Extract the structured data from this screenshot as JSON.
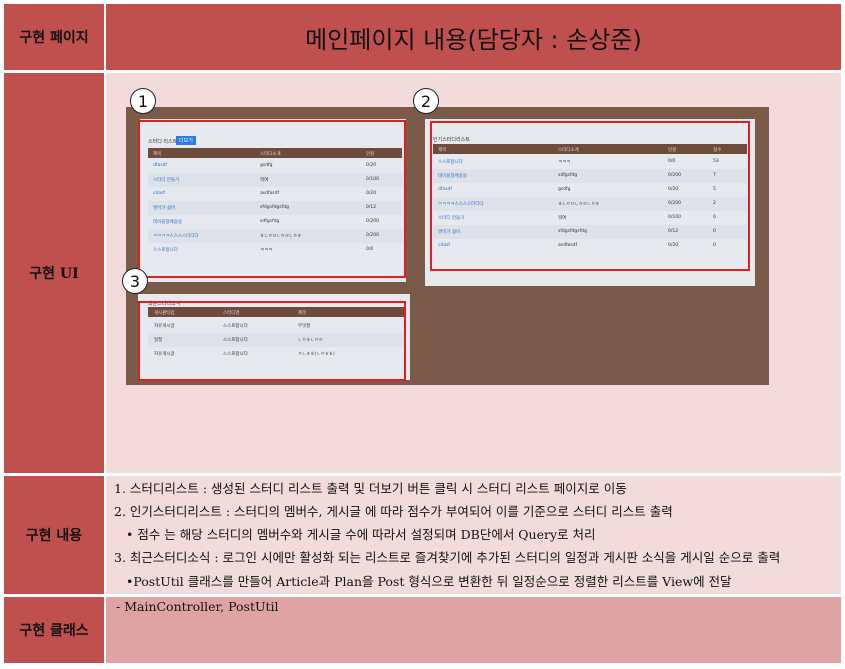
{
  "header": {
    "label": "구현 페이지",
    "title": "메인페이지 내용(담당자 : 손상준)"
  },
  "ui_section": {
    "label": "구현 UI"
  },
  "content_section": {
    "label": "구현 내용",
    "lines": [
      "1. 스터디리스트 : 생성된 스터디 리스트 출력 및 더보기 버튼 클릭 시 스터디 리스트 페이지로 이동",
      "2. 인기스터디리스트 : 스터디의 멤버수, 게시글 에 따라 점수가 부여되어 이를 기준으로 스터디 리스트 출력",
      "• 점수 는 해당 스터디의 멤버수와 게시글 수에 따라서 설정되며 DB단에서 Query로 처리",
      "3. 최근스터디소식 : 로그인 시에만 활성화 되는 리스트로 즐겨찾기에 추가된 스터디의 일정과 게시판 소식을 게시일 순으로 출력",
      "•PostUtil 클래스를 만들어 Article과 Plan을 Post 형식으로 변환한 뒤 일정순으로 정렬한 리스트를 View에 전달"
    ]
  },
  "class_section": {
    "label": "구현 클래스",
    "text": "- MainController, PostUtil"
  },
  "badges": [
    "1",
    "2",
    "3"
  ],
  "panel1": {
    "title": "스터디 리스트",
    "more": "더보기",
    "headers": [
      "제목",
      "스터디소개",
      "인원"
    ],
    "rows": [
      [
        "dfasdf",
        "gsdfg",
        "0/20"
      ],
      [
        "스터디 만들기",
        "뭐여",
        "0/100"
      ],
      [
        "cdasf",
        "asdfasdf",
        "0/20"
      ],
      [
        "영어가 싫어",
        "sfdgsfdgsfdg",
        "0/12"
      ],
      [
        "테이블형페용용",
        "sdfgsfdg",
        "0/200"
      ],
      [
        "ㅋㅋㅋㅋ스스스스터디다",
        "ㅎㄴㅇㅁㄴㅇㄹㄴㅇㅎ",
        "0/200"
      ],
      [
        "스스로합니다",
        "ㅋㅋㅋ",
        "0/0"
      ]
    ]
  },
  "panel2": {
    "title": "인기스터디리스트",
    "headers": [
      "제목",
      "스터디소개",
      "인원",
      "점수"
    ],
    "rows": [
      [
        "스스로합니다",
        "ㅋㅋㅋ",
        "0/0",
        "53"
      ],
      [
        "테이블형페용용",
        "sdfgsfdg",
        "0/200",
        "7"
      ],
      [
        "dfasdf",
        "gsdfg",
        "0/20",
        "5"
      ],
      [
        "ㅋㅋㅋㅋ스스스스터디다",
        "ㅎㄴㅇㅁㄴㅇㄹㄴㅇㅎ",
        "0/200",
        "2"
      ],
      [
        "스터디 만들기",
        "뭐여",
        "0/100",
        "0"
      ],
      [
        "영어가 싫어",
        "sfdgsfdgsfdg",
        "0/12",
        "0"
      ],
      [
        "cdasf",
        "asdfasdf",
        "0/20",
        "0"
      ]
    ]
  },
  "panel3": {
    "title": "최근스터디소식",
    "headers": [
      "게시판타입",
      "스터디명",
      "제목"
    ],
    "rows": [
      [
        "자유게시글",
        "스스로합니다",
        "무엇할"
      ],
      [
        "일정",
        "스스로합니다",
        "ㄴㅇㅎㄴㅇㄹ"
      ],
      [
        "자유게시글",
        "스스로합니다",
        "ㅇㄴㅎㅎ(ㄴㅇㅎㅎ)"
      ]
    ]
  }
}
